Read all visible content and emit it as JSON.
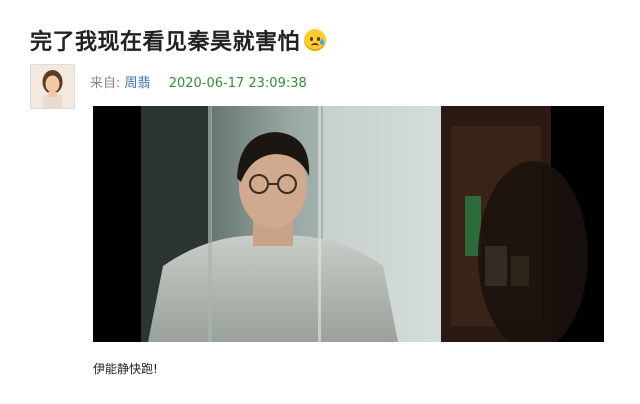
{
  "post": {
    "title": "完了我现在看见秦昊就害怕",
    "emoji_icon": "sad-tear-emoji-icon",
    "source_label": "来自:",
    "author": "周翡",
    "timestamp": "2020-06-17 23:09:38",
    "caption": "伊能静快跑!"
  }
}
